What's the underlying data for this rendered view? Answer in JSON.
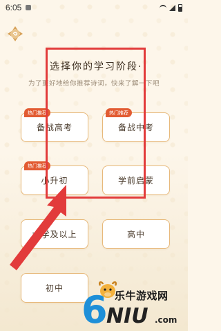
{
  "status_bar": {
    "time": "6:05"
  },
  "header": {
    "logo_icon": "app-logo-icon",
    "title": "·选择你的学习阶段·",
    "subtitle": "为了更好地给你推荐诗词，快来了解一下吧"
  },
  "options": [
    {
      "label": "备战高考",
      "badge": "热门推荐"
    },
    {
      "label": "备战中考",
      "badge": "热门推荐"
    },
    {
      "label": "小升初",
      "badge": "热门推荐"
    },
    {
      "label": "学前启蒙",
      "badge": ""
    },
    {
      "label": "大学及以上",
      "badge": ""
    },
    {
      "label": "高中",
      "badge": ""
    },
    {
      "label": "初中",
      "badge": ""
    }
  ],
  "watermark": {
    "text": "乐牛游戏网",
    "logo_letters": "6NIU.com"
  },
  "colors": {
    "background": "#fdf6ea",
    "card_border": "#e7b97b",
    "badge": "#e25b32",
    "annotation": "#e23b3b"
  }
}
